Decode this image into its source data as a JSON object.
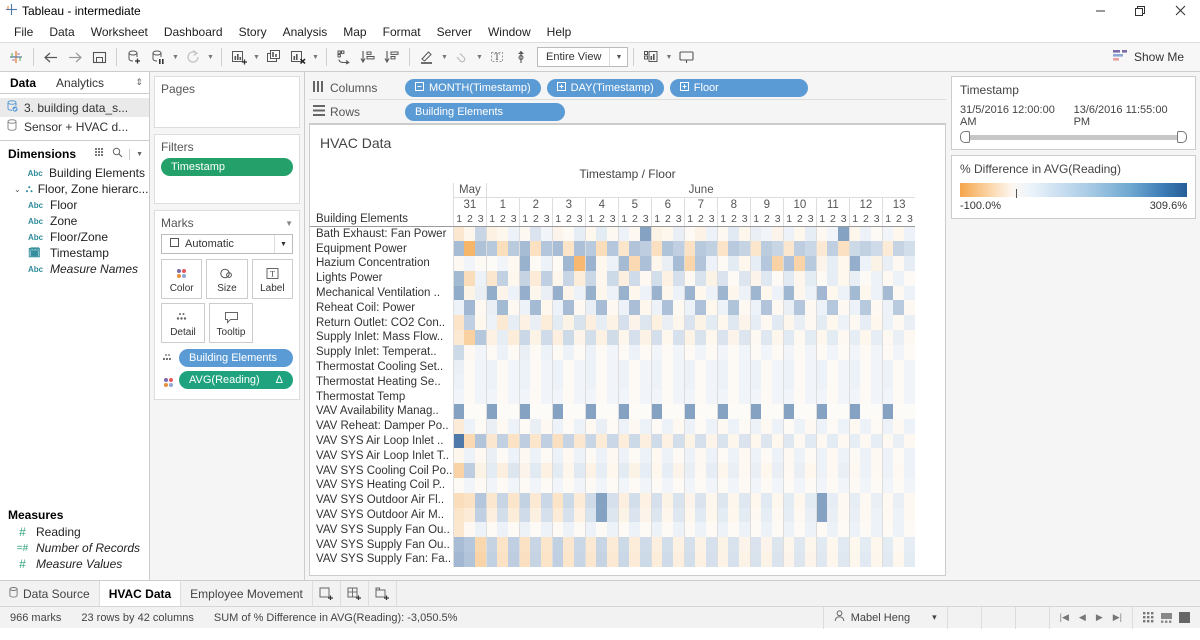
{
  "window": {
    "title": "Tableau - intermediate",
    "logo_icon": "tableau-logo-icon",
    "minimize": "—",
    "maximize": "❐",
    "close": "✕"
  },
  "menubar": {
    "items": [
      "File",
      "Data",
      "Worksheet",
      "Dashboard",
      "Story",
      "Analysis",
      "Map",
      "Format",
      "Server",
      "Window",
      "Help"
    ]
  },
  "toolbar": {
    "logo_icon": "tableau-sparkle-icon",
    "back_icon": "arrow-left-icon",
    "forward_icon": "arrow-right-icon",
    "save_icon": "save-icon",
    "new_data_source_icon": "new-data-source-icon",
    "pause_data_source_icon": "pause-auto-updates-icon",
    "refresh_icon": "refresh-data-source-icon",
    "new_worksheet_icon": "new-worksheet-icon",
    "duplicate_icon": "duplicate-sheet-icon",
    "clear_sheet_icon": "clear-sheet-icon",
    "swap_icon": "swap-rows-columns-icon",
    "sort_asc_icon": "sort-ascending-icon",
    "sort_desc_icon": "sort-descending-icon",
    "highlight_icon": "highlighter-icon",
    "group_icon": "group-members-icon",
    "labels_icon": "show-mark-labels-icon",
    "fixed_axis_icon": "fix-axes-icon",
    "fit_label": "Entire View",
    "presentation_icon": "presentation-mode-icon",
    "device_layout_icon": "show-cards-icon",
    "showme_label": "Show Me",
    "showme_icon": "show-me-icon"
  },
  "datapane": {
    "tabs": [
      {
        "label": "Data",
        "active": true
      },
      {
        "label": "Analytics",
        "active": false
      }
    ],
    "tab_menu_icon": "updown-arrow-icon",
    "datasources": [
      {
        "label": "3. building data_s...",
        "icon": "data-source-connected-icon",
        "selected": true
      },
      {
        "label": "Sensor + HVAC d...",
        "icon": "data-source-icon",
        "selected": false
      }
    ],
    "dimensions": {
      "heading": "Dimensions",
      "grid_icon": "view-data-grid-icon",
      "search_icon": "search-icon",
      "menu_icon": "dropdown-caret-icon",
      "fields": [
        {
          "label": "Building Elements",
          "type": "Abc",
          "italic": false,
          "indent": 0,
          "expander": ""
        },
        {
          "label": "Floor, Zone hierarc...",
          "type": "hier",
          "italic": false,
          "indent": 0,
          "expander": "⌄"
        },
        {
          "label": "Floor",
          "type": "Abc",
          "italic": false,
          "indent": 1,
          "expander": ""
        },
        {
          "label": "Zone",
          "type": "Abc",
          "italic": false,
          "indent": 1,
          "expander": ""
        },
        {
          "label": "Floor/Zone",
          "type": "Abc",
          "italic": false,
          "indent": 0,
          "expander": ""
        },
        {
          "label": "Timestamp",
          "type": "date",
          "italic": false,
          "indent": 0,
          "expander": ""
        },
        {
          "label": "Measure Names",
          "type": "Abc",
          "italic": true,
          "indent": 0,
          "expander": ""
        }
      ]
    },
    "measures": {
      "heading": "Measures",
      "fields": [
        {
          "label": "Reading",
          "type": "#",
          "italic": false
        },
        {
          "label": "Number of Records",
          "type": "=#",
          "italic": true
        },
        {
          "label": "Measure Values",
          "type": "#",
          "italic": true
        }
      ]
    }
  },
  "shelves": {
    "pages": {
      "title": "Pages"
    },
    "filters": {
      "title": "Filters",
      "pills": [
        "Timestamp"
      ]
    },
    "marks": {
      "title": "Marks",
      "caret_icon": "collapse-caret-icon",
      "mark_type": "Automatic",
      "mark_type_icon": "automatic-mark-icon",
      "cards": [
        {
          "label": "Color",
          "icon": "color-icon"
        },
        {
          "label": "Size",
          "icon": "size-icon"
        },
        {
          "label": "Label",
          "icon": "label-icon"
        },
        {
          "label": "Detail",
          "icon": "detail-icon"
        },
        {
          "label": "Tooltip",
          "icon": "tooltip-icon"
        }
      ],
      "pills": [
        {
          "label": "Building Elements",
          "prop_icon": "detail-icon",
          "color": "blue",
          "suffix": ""
        },
        {
          "label": "AVG(Reading)",
          "prop_icon": "color-icon",
          "color": "teal",
          "suffix": "Δ"
        }
      ]
    }
  },
  "columns_shelf": {
    "label": "Columns",
    "icon": "columns-icon",
    "pills": [
      {
        "label": "MONTH(Timestamp)",
        "expand_icon": "minus-box-icon"
      },
      {
        "label": "DAY(Timestamp)",
        "expand_icon": "plus-box-icon"
      },
      {
        "label": "Floor",
        "expand_icon": "plus-box-icon"
      }
    ]
  },
  "rows_shelf": {
    "label": "Rows",
    "icon": "rows-icon",
    "pills": [
      {
        "label": "Building Elements"
      }
    ]
  },
  "viz": {
    "title": "HVAC Data",
    "column_super_header": "Timestamp / Floor",
    "row_header_label": "Building Elements"
  },
  "right_panel": {
    "timestamp_filter": {
      "title": "Timestamp",
      "min_label": "31/5/2016 12:00:00 AM",
      "max_label": "13/6/2016 11:55:00 PM"
    },
    "color_legend": {
      "title": "% Difference in AVG(Reading)",
      "min_label": "-100.0%",
      "max_label": "309.6%",
      "low_color": "#f5a54a",
      "mid_color": "#f7f7f7",
      "high_color": "#265d96"
    }
  },
  "worksheet_tabs": {
    "items": [
      {
        "label": "Data Source",
        "icon": "data-source-icon",
        "active": false
      },
      {
        "label": "HVAC Data",
        "icon": "",
        "active": true
      },
      {
        "label": "Employee Movement",
        "icon": "",
        "active": false
      }
    ],
    "new_worksheet_icon": "new-worksheet-icon",
    "new_dashboard_icon": "new-dashboard-icon",
    "new_story_icon": "new-story-icon"
  },
  "statusbar": {
    "marks": "966 marks",
    "rows_cols": "23 rows by 42 columns",
    "aggregate": "SUM of % Difference in AVG(Reading): -3,050.5%",
    "user": "Mabel Heng",
    "user_icon": "user-icon",
    "user_caret": "▾",
    "nav_first": "|◀",
    "nav_prev": "◀",
    "nav_next": "▶",
    "nav_last": "▶|",
    "view_icons": [
      "grid-view-icon",
      "filmstrip-view-icon",
      "sheet-view-icon"
    ]
  },
  "chart_data": {
    "type": "heatmap",
    "title": "HVAC Data",
    "xlabel": "Timestamp / Floor",
    "ylabel": "Building Elements",
    "color_measure": "% Difference in AVG(Reading)",
    "color_range": [
      -100.0,
      309.6
    ],
    "months": [
      {
        "name": "May",
        "days": [
          "31"
        ]
      },
      {
        "name": "June",
        "days": [
          "1",
          "2",
          "3",
          "4",
          "5",
          "6",
          "7",
          "8",
          "9",
          "10",
          "11",
          "12",
          "13"
        ]
      }
    ],
    "floors": [
      "1",
      "2",
      "3"
    ],
    "rows": [
      "Bath Exhaust: Fan Power",
      "Equipment Power",
      "Hazium Concentration",
      "Lights Power",
      "Mechanical Ventilation ..",
      "Reheat Coil: Power",
      "Return Outlet: CO2 Con..",
      "Supply Inlet: Mass Flow..",
      "Supply Inlet: Temperat..",
      "Thermostat Cooling Set..",
      "Thermostat Heating Se..",
      "Thermostat Temp",
      "VAV Availability Manag..",
      "VAV Reheat: Damper Po..",
      "VAV SYS Air Loop Inlet ..",
      "VAV SYS Air Loop Inlet T..",
      "VAV SYS Cooling Coil Po..",
      "VAV SYS Heating Coil P..",
      "VAV SYS Outdoor Air Fl..",
      "VAV SYS Outdoor Air M..",
      "VAV SYS Supply Fan Ou..",
      "VAV SYS Supply Fan Ou..",
      "VAV SYS Supply Fan: Fa.."
    ],
    "values": [
      [
        -18,
        -4,
        22,
        -8,
        -3,
        2,
        -2,
        9,
        1,
        -5,
        -1,
        4,
        -3,
        5,
        -2,
        2,
        -2,
        100,
        -6,
        -3,
        3,
        -1,
        -7,
        2,
        -2,
        6,
        -4,
        3,
        1,
        -5,
        2,
        -3,
        4,
        -2,
        1,
        100,
        -4,
        2,
        -1,
        1,
        -3,
        2
      ],
      [
        55,
        -80,
        45,
        36,
        -28,
        33,
        55,
        -25,
        40,
        52,
        -22,
        48,
        35,
        -30,
        38,
        -20,
        42,
        30,
        -26,
        44,
        28,
        -24,
        36,
        26,
        -22,
        34,
        24,
        -20,
        32,
        22,
        -18,
        30,
        20,
        -16,
        28,
        -25,
        18,
        26,
        16,
        -14,
        24,
        14
      ],
      [
        -2,
        1,
        -1,
        0,
        1,
        -2,
        72,
        -1,
        2,
        -1,
        62,
        -75,
        68,
        -3,
        2,
        56,
        -34,
        48,
        -4,
        3,
        55,
        -38,
        42,
        2,
        -1,
        5,
        -3,
        4,
        38,
        -42,
        46,
        -40,
        35,
        -5,
        4,
        -3,
        78,
        2,
        -6,
        3,
        -2,
        4
      ],
      [
        58,
        -30,
        2,
        -18,
        26,
        -3,
        24,
        -14,
        28,
        -4,
        22,
        -12,
        20,
        -3,
        18,
        -10,
        16,
        -2,
        14,
        -8,
        12,
        -2,
        10,
        -6,
        9,
        -1,
        8,
        -5,
        7,
        -1,
        6,
        -4,
        5,
        -1,
        4,
        -3,
        3,
        -1,
        2,
        -2,
        2,
        -1
      ],
      [
        82,
        -6,
        3,
        80,
        -5,
        2,
        78,
        -4,
        3,
        76,
        -5,
        2,
        74,
        -4,
        2,
        72,
        -3,
        2,
        70,
        -4,
        2,
        68,
        -3,
        2,
        66,
        -4,
        2,
        64,
        -3,
        2,
        62,
        -4,
        2,
        60,
        -3,
        2,
        58,
        -3,
        2,
        56,
        -2,
        2
      ],
      [
        2,
        60,
        -2,
        3,
        58,
        -2,
        2,
        56,
        -3,
        2,
        54,
        -2,
        3,
        52,
        -2,
        2,
        50,
        -3,
        2,
        48,
        -2,
        2,
        46,
        -3,
        2,
        44,
        -2,
        2,
        42,
        -2,
        3,
        40,
        -2,
        2,
        38,
        -2,
        2,
        36,
        -2,
        2,
        34,
        -2
      ],
      [
        -22,
        28,
        -3,
        2,
        -16,
        4,
        -8,
        3,
        -12,
        5,
        -6,
        10,
        -10,
        4,
        -7,
        12,
        -5,
        8,
        -9,
        3,
        -4,
        9,
        -6,
        5,
        -3,
        7,
        -5,
        4,
        -2,
        6,
        -4,
        3,
        -2,
        5,
        -3,
        2,
        -2,
        4,
        -3,
        2,
        -2,
        3
      ],
      [
        -16,
        -46,
        38,
        -8,
        4,
        -12,
        20,
        -6,
        16,
        -10,
        18,
        -5,
        14,
        -8,
        15,
        -4,
        12,
        -7,
        13,
        -3,
        11,
        -6,
        10,
        -3,
        9,
        -5,
        8,
        -2,
        7,
        -4,
        6,
        -2,
        5,
        -3,
        5,
        -2,
        4,
        -3,
        4,
        -2,
        3,
        -2
      ],
      [
        18,
        -2,
        1,
        -1,
        2,
        -1,
        3,
        -1,
        2,
        -1,
        2,
        -1,
        2,
        -1,
        1,
        -1,
        2,
        -1,
        1,
        -1,
        1,
        -1,
        1,
        -1,
        1,
        -1,
        1,
        -1,
        1,
        -1,
        1,
        -1,
        1,
        -1,
        1,
        -1,
        1,
        -1,
        1,
        -1,
        1,
        -1
      ],
      [
        3,
        -1,
        1,
        2,
        -1,
        1,
        2,
        -1,
        1,
        2,
        -1,
        1,
        2,
        -1,
        1,
        2,
        -1,
        1,
        2,
        -1,
        1,
        2,
        -1,
        1,
        2,
        -1,
        1,
        2,
        -1,
        1,
        2,
        -1,
        1,
        2,
        -1,
        1,
        2,
        -1,
        1,
        2,
        -1,
        1
      ],
      [
        2,
        -1,
        1,
        2,
        -1,
        1,
        2,
        -1,
        1,
        2,
        -1,
        1,
        2,
        -1,
        1,
        2,
        -1,
        1,
        2,
        -1,
        1,
        2,
        -1,
        1,
        2,
        -1,
        1,
        2,
        -1,
        1,
        2,
        -1,
        1,
        2,
        -1,
        1,
        2,
        -1,
        1,
        2,
        -1,
        1
      ],
      [
        1,
        -1,
        1,
        1,
        -1,
        1,
        1,
        -1,
        1,
        1,
        -1,
        1,
        1,
        -1,
        1,
        1,
        -1,
        1,
        1,
        -1,
        1,
        1,
        -1,
        1,
        1,
        -1,
        1,
        1,
        -1,
        1,
        1,
        -1,
        1,
        1,
        -1,
        1,
        1,
        -1,
        1,
        1,
        -1,
        1
      ],
      [
        100,
        0,
        0,
        100,
        0,
        0,
        100,
        0,
        0,
        100,
        0,
        0,
        100,
        0,
        0,
        100,
        0,
        0,
        100,
        0,
        0,
        100,
        0,
        0,
        100,
        0,
        0,
        100,
        0,
        0,
        100,
        0,
        0,
        100,
        0,
        0,
        100,
        0,
        0,
        100,
        0,
        0
      ],
      [
        -14,
        2,
        -1,
        3,
        -2,
        2,
        -1,
        3,
        -2,
        2,
        -1,
        2,
        -2,
        3,
        -1,
        2,
        -2,
        2,
        -1,
        2,
        -2,
        2,
        -1,
        2,
        -2,
        2,
        -1,
        2,
        -2,
        2,
        -1,
        2,
        -2,
        2,
        -1,
        2,
        -2,
        2,
        -1,
        2,
        -2,
        2
      ],
      [
        200,
        -34,
        42,
        -18,
        26,
        -24,
        30,
        -20,
        28,
        -26,
        24,
        -18,
        22,
        -14,
        20,
        -12,
        18,
        -10,
        16,
        -8,
        14,
        -6,
        12,
        -5,
        10,
        -4,
        9,
        -3,
        8,
        -3,
        7,
        -2,
        6,
        -2,
        5,
        -2,
        4,
        -2,
        4,
        -2,
        3,
        -2
      ],
      [
        -4,
        2,
        -2,
        3,
        -1,
        2,
        -2,
        2,
        -1,
        2,
        -2,
        2,
        -1,
        2,
        -2,
        2,
        -1,
        2,
        -2,
        2,
        -1,
        2,
        -2,
        2,
        -1,
        2,
        -2,
        2,
        -1,
        2,
        -2,
        2,
        -1,
        2,
        -2,
        2,
        -1,
        2,
        -2,
        2,
        -1,
        2
      ],
      [
        -42,
        30,
        -6,
        5,
        -10,
        8,
        -5,
        6,
        -8,
        5,
        -4,
        6,
        -7,
        4,
        -3,
        5,
        -6,
        4,
        -3,
        4,
        -5,
        3,
        -2,
        4,
        -4,
        3,
        -2,
        3,
        -3,
        3,
        -2,
        3,
        -3,
        2,
        -2,
        3,
        -2,
        2,
        -2,
        2,
        -2,
        2
      ],
      [
        -1,
        1,
        -1,
        1,
        -1,
        1,
        -1,
        1,
        -1,
        1,
        -1,
        1,
        -1,
        1,
        -1,
        1,
        -1,
        1,
        -1,
        1,
        -1,
        1,
        -1,
        1,
        -1,
        1,
        -1,
        1,
        -1,
        1,
        -1,
        1,
        -1,
        1,
        -1,
        1,
        -1,
        1,
        -1,
        1,
        -1,
        1
      ],
      [
        -30,
        -24,
        40,
        -18,
        22,
        -20,
        25,
        -16,
        20,
        -22,
        18,
        -14,
        16,
        100,
        12,
        -10,
        14,
        -8,
        12,
        -6,
        10,
        -5,
        9,
        -4,
        8,
        -4,
        7,
        -3,
        6,
        -3,
        5,
        -3,
        5,
        100,
        4,
        -2,
        4,
        -2,
        3,
        -2,
        3,
        -2
      ],
      [
        -20,
        -14,
        28,
        -10,
        14,
        -12,
        16,
        -9,
        12,
        -14,
        11,
        -8,
        10,
        100,
        8,
        -6,
        9,
        -5,
        8,
        -4,
        7,
        -3,
        6,
        -3,
        5,
        -3,
        5,
        -2,
        4,
        -2,
        4,
        -2,
        3,
        100,
        3,
        -2,
        3,
        -2,
        2,
        -2,
        2,
        -2
      ],
      [
        -18,
        -2,
        2,
        -1,
        2,
        -1,
        2,
        -1,
        2,
        -1,
        2,
        -1,
        2,
        -1,
        2,
        -1,
        2,
        -1,
        2,
        -1,
        2,
        -1,
        2,
        -1,
        2,
        -1,
        2,
        -1,
        2,
        -1,
        2,
        -1,
        2,
        -1,
        2,
        -1,
        2,
        -1,
        2,
        -1,
        2,
        -1
      ],
      [
        52,
        38,
        -36,
        24,
        -22,
        28,
        -24,
        22,
        -20,
        26,
        -18,
        20,
        -16,
        22,
        -14,
        18,
        -12,
        16,
        -10,
        14,
        -8,
        12,
        -7,
        11,
        -6,
        10,
        -5,
        9,
        -5,
        8,
        -4,
        7,
        -4,
        6,
        -3,
        6,
        -3,
        5,
        -3,
        5,
        -2,
        4
      ],
      [
        60,
        42,
        -40,
        26,
        -24,
        30,
        -26,
        24,
        -22,
        28,
        -20,
        22,
        -18,
        24,
        -16,
        20,
        -14,
        18,
        -12,
        16,
        -10,
        14,
        -8,
        12,
        -7,
        11,
        -6,
        10,
        -6,
        9,
        -5,
        8,
        -5,
        7,
        -4,
        7,
        -4,
        6,
        -4,
        6,
        -3,
        5
      ]
    ]
  }
}
